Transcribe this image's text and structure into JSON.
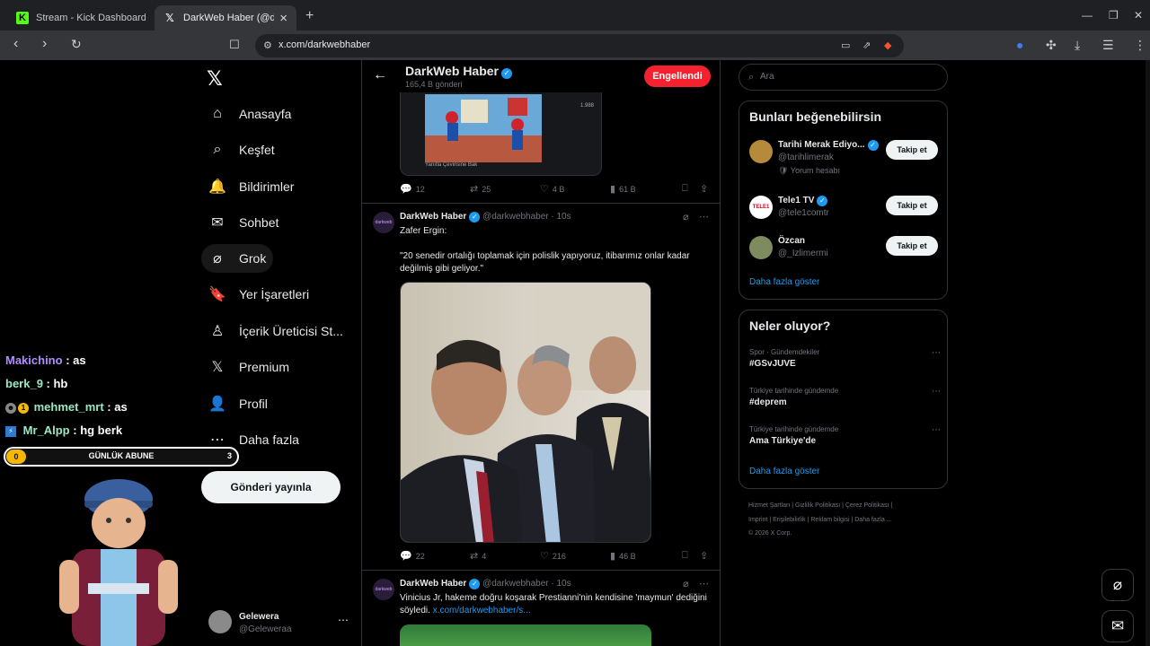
{
  "browser": {
    "tabs": [
      {
        "title": "Stream - Kick Dashboard",
        "favicon": "K"
      },
      {
        "title": "DarkWeb Haber (@darkwebh",
        "favicon": "𝕏"
      }
    ],
    "url": "x.com/darkwebhaber"
  },
  "nav": {
    "logo": "𝕏",
    "items": [
      {
        "label": "Anasayfa",
        "icon": "⌂"
      },
      {
        "label": "Keşfet",
        "icon": "⌕"
      },
      {
        "label": "Bildirimler",
        "icon": "🔔"
      },
      {
        "label": "Sohbet",
        "icon": "✉"
      },
      {
        "label": "Grok",
        "icon": "⌀"
      },
      {
        "label": "Yer İşaretleri",
        "icon": "🔖"
      },
      {
        "label": "İçerik Üreticisi St...",
        "icon": "♙"
      },
      {
        "label": "Premium",
        "icon": "𝕏"
      },
      {
        "label": "Profil",
        "icon": "👤"
      },
      {
        "label": "Daha fazla",
        "icon": "⋯"
      }
    ],
    "post_button": "Gönderi yayınla",
    "account": {
      "name": "Gelewera",
      "handle": "@Geleweraa"
    }
  },
  "stream_overlay": {
    "chat": [
      {
        "user": "Makichino",
        "msg": ": as"
      },
      {
        "user": "berk_9",
        "msg": ": hb"
      },
      {
        "user": "mehmet_mrt",
        "msg": ": as"
      },
      {
        "user": "Mr_Alpp",
        "msg": ": hg berk"
      }
    ],
    "sub_goal": {
      "label": "GÜNLÜK ABUNE",
      "current": "0",
      "target": "3"
    }
  },
  "profile_header": {
    "name": "DarkWeb Haber",
    "posts": "165,4 B gönderi",
    "blocked_label": "Engellendi"
  },
  "timeline": {
    "top_media": {
      "caption": "Yanıtla    Çevirisine Bak",
      "count": "1.988"
    },
    "top_actions": {
      "replies": "12",
      "reposts": "25",
      "likes": "4 B",
      "views": "61 B"
    },
    "tweet1": {
      "name": "DarkWeb Haber",
      "handle_time": "@darkwebhaber · 10s",
      "line1": "Zafer Ergin:",
      "line2": "\"20 senedir ortalığı toplamak için polislik yapıyoruz, itibarımız onlar kadar değilmiş gibi geliyor.\"",
      "actions": {
        "replies": "22",
        "reposts": "4",
        "likes": "216",
        "views": "46 B"
      }
    },
    "tweet2": {
      "name": "DarkWeb Haber",
      "handle_time": "@darkwebhaber · 10s",
      "text": "Vinicius Jr, hakeme doğru koşarak Prestianni'nin kendisine 'maymun' dediğini söyledi.",
      "link": "x.com/darkwebhaber/s..."
    }
  },
  "right": {
    "search_placeholder": "Ara",
    "suggestions_title": "Bunları beğenebilirsin",
    "suggestions": [
      {
        "name": "Tarihi Merak Ediyo...",
        "handle": "@tarihlimerak",
        "extra": "Yorum hesabı",
        "follow": "Takip et"
      },
      {
        "name": "Tele1 TV",
        "handle": "@tele1comtr",
        "follow": "Takip et",
        "avatar_text": "TELE1"
      },
      {
        "name": "Özcan",
        "handle": "@_Izlimermi",
        "follow": "Takip et"
      }
    ],
    "show_more": "Daha fazla göster",
    "trends_title": "Neler oluyor?",
    "trends": [
      {
        "context": "Spor · Gündemdekiler",
        "title": "#GSvJUVE"
      },
      {
        "context": "Türkiye tarihinde gündemde",
        "title": "#deprem"
      },
      {
        "context": "Türkiye tarihinde gündemde",
        "title": "Ama Türkiye'de"
      }
    ],
    "trends_more": "Daha fazla göster",
    "footer1": "Hizmet Şartları  |  Gizlilik Politikası  |  Çerez Politikası  |",
    "footer2": "Imprint  |  Erişilebilirlik  |  Reklam bilgisi  |  Daha fazla ...",
    "footer3": "© 2026 X Corp."
  }
}
